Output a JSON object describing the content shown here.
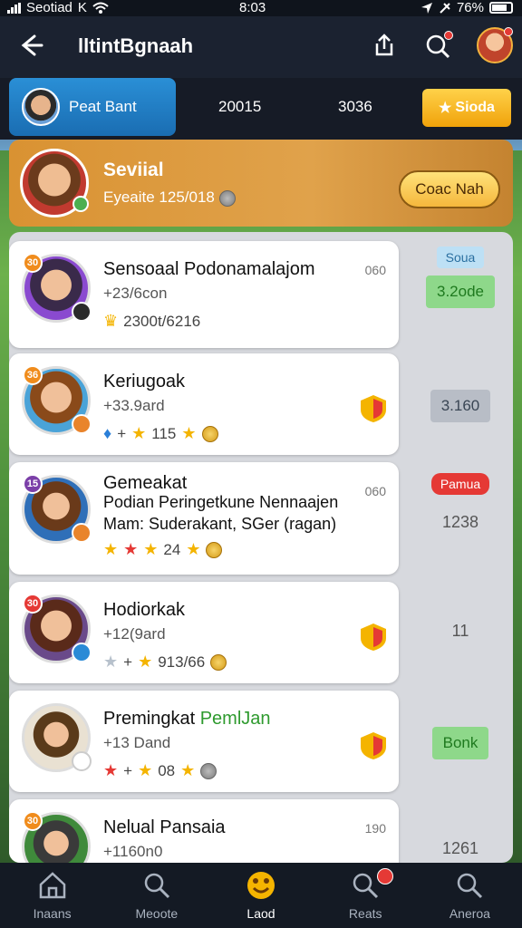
{
  "status_bar": {
    "carrier": "Seotiad",
    "carrier_suffix": "K",
    "time": "8:03",
    "battery": "76%"
  },
  "app_bar": {
    "title": "lltintBgnaah"
  },
  "tab_strip": {
    "player_label": "Peat Bant",
    "num_1": "20015",
    "num_2": "3036",
    "button_label": "Sioda"
  },
  "header_card": {
    "title": "Seviial",
    "subtitle": "Eyeaite 125/018",
    "button_label": "Coac Nah"
  },
  "cards": [
    {
      "rank": "30",
      "name": "Sensoaal Podonamalajom",
      "sub": "+23/6con",
      "stat": "2300t/6216",
      "count": "060",
      "right_label": "3.2ode",
      "right_top": "Soua",
      "colors": {
        "avatar": "#5a3f7a",
        "rank": "#f08c1c",
        "badge": "#2b2b2b"
      }
    },
    {
      "rank": "36",
      "name": "Keriugoak",
      "sub": "+33.9ard",
      "stat": "115",
      "right_label": "3.160",
      "colors": {
        "avatar": "#4aa3d8",
        "rank": "#f08c1c",
        "badge": "#e9842b"
      }
    },
    {
      "rank": "15",
      "name": "Gemeakat",
      "sub": "Podian Peringetkune Nennaajen",
      "sub2": "Mam: Suderakant, SGer (ragan)",
      "stat": "24",
      "count": "060",
      "right_label": "1238",
      "right_top": "Pamua",
      "colors": {
        "avatar": "#2f6fb8",
        "rank": "#7b3fa8",
        "badge": "#e9842b"
      }
    },
    {
      "rank": "30",
      "name": "Hodiorkak",
      "sub": "+12(9ard",
      "stat": "913/66",
      "right_label": "11",
      "colors": {
        "avatar": "#6a4a8a",
        "rank": "#e53935",
        "badge": "#2a8ad6"
      }
    },
    {
      "rank": "",
      "name_a": "Premingkat",
      "name_b": "PemlJan",
      "sub": "+13 Dand",
      "stat": "08",
      "right_label": "Bonk",
      "colors": {
        "avatar": "#e9e1d2",
        "badge": "#ffffff"
      }
    },
    {
      "rank": "30",
      "name": "Nelual Pansaia",
      "sub": "+1160n0",
      "count": "190",
      "right_label": "1261",
      "colors": {
        "avatar": "#3f8a3b",
        "rank": "#f08c1c"
      }
    }
  ],
  "bottom_nav": [
    {
      "label": "Inaans",
      "icon": "home-icon"
    },
    {
      "label": "Meoote",
      "icon": "search-icon"
    },
    {
      "label": "Laod",
      "icon": "paw-icon"
    },
    {
      "label": "Reats",
      "icon": "search-icon"
    },
    {
      "label": "Aneroa",
      "icon": "search-icon"
    }
  ],
  "accent_colors": {
    "blue": "#1a6db2",
    "gold": "#f0a20a",
    "green_pill": "#8ed88a",
    "red_pill": "#e53935"
  }
}
